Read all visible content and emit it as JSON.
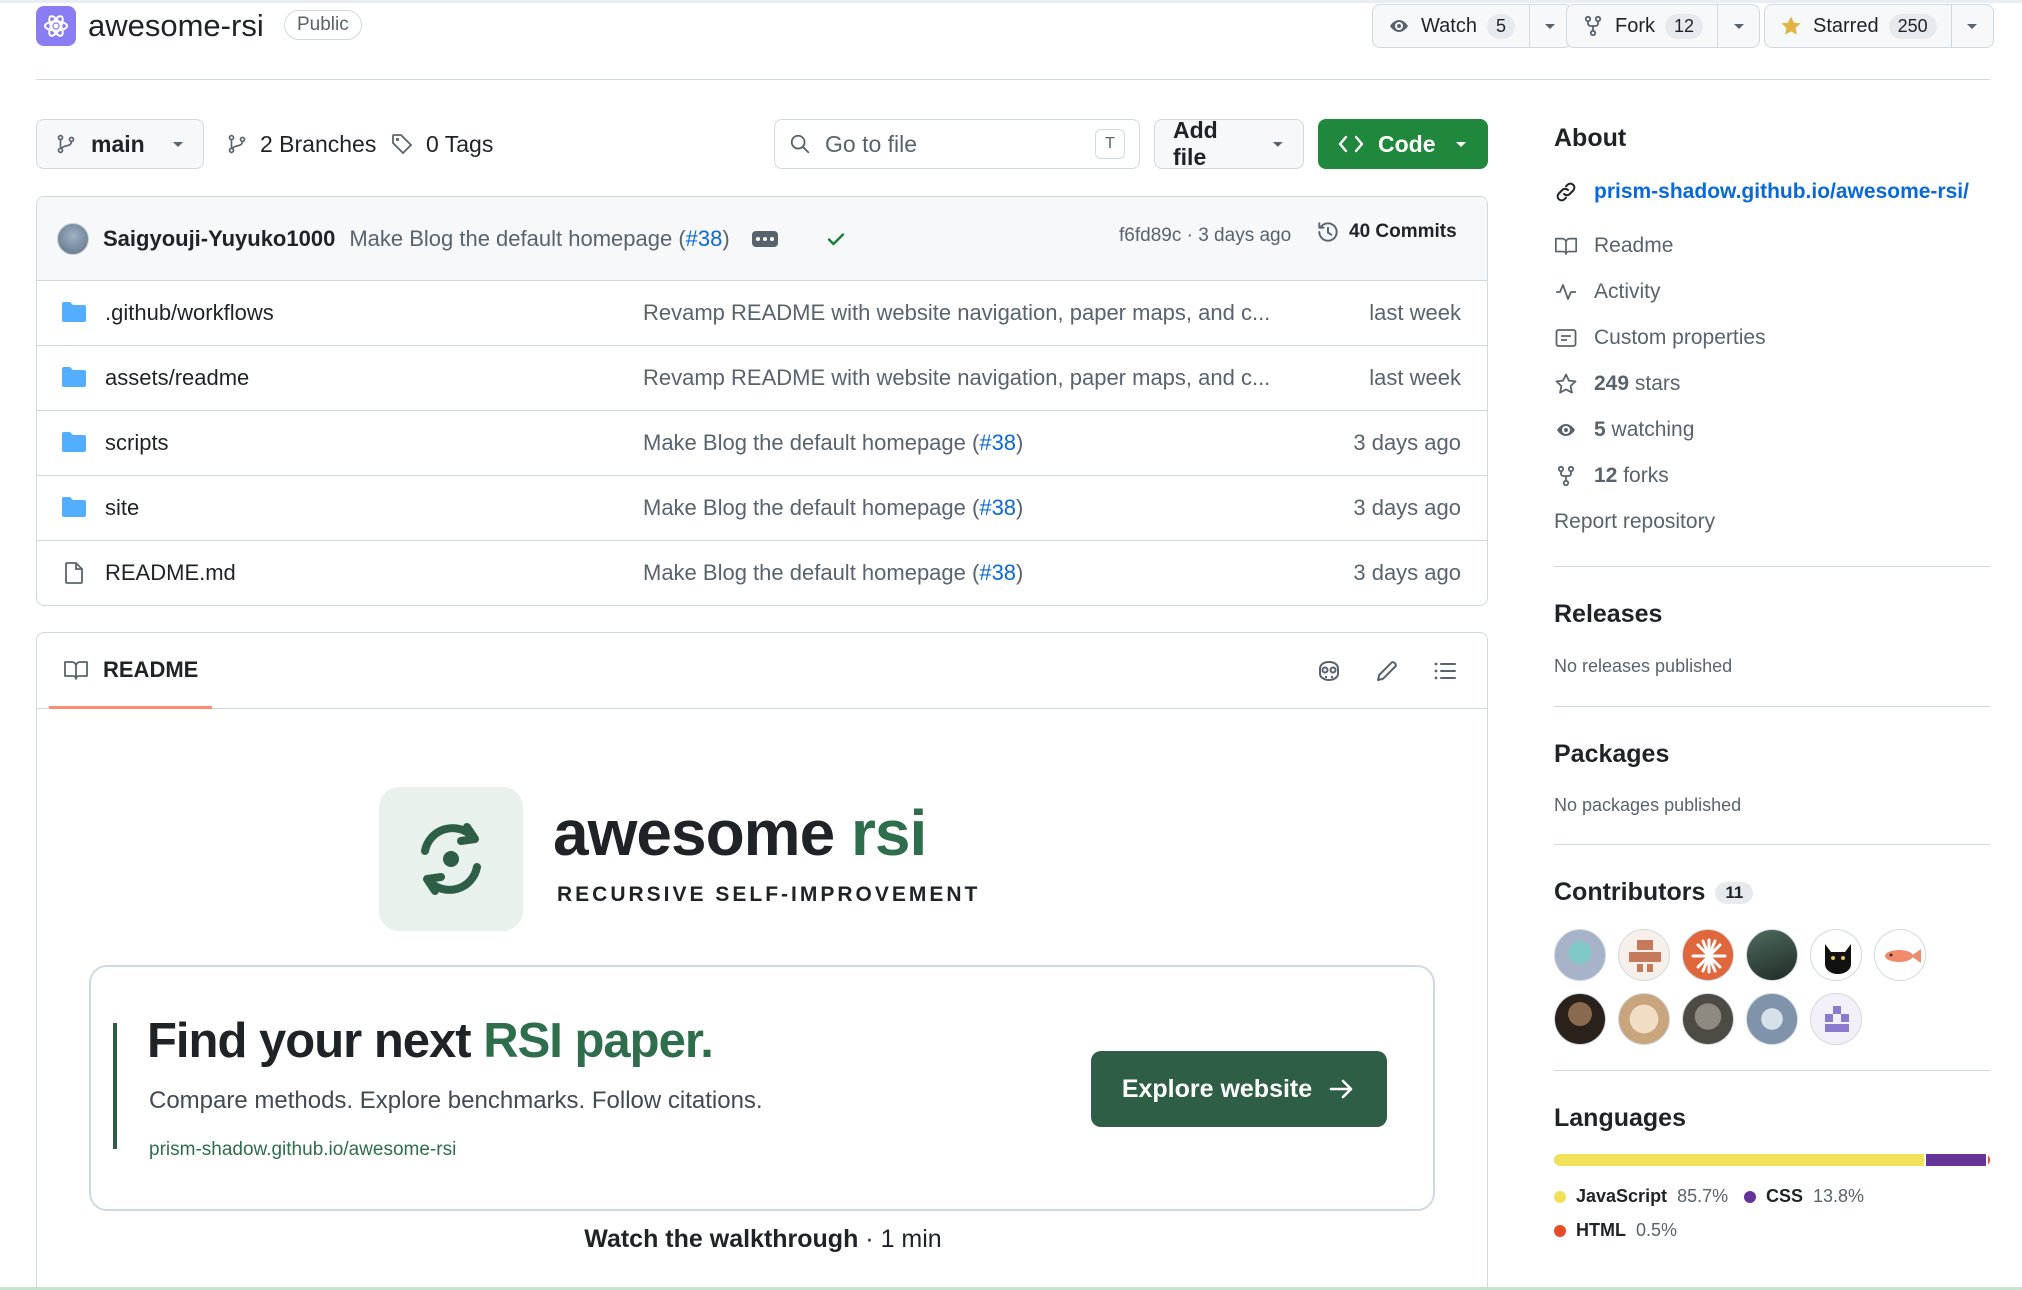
{
  "repo": {
    "name": "awesome-rsi",
    "visibility": "Public"
  },
  "header_actions": {
    "watch": {
      "label": "Watch",
      "count": "5"
    },
    "fork": {
      "label": "Fork",
      "count": "12"
    },
    "star": {
      "label": "Starred",
      "count": "250"
    }
  },
  "branch_bar": {
    "branch": "main",
    "branches": "2 Branches",
    "tags": "0 Tags",
    "search_placeholder": "Go to file",
    "search_shortcut": "T",
    "add_file": "Add file",
    "code": "Code"
  },
  "latest_commit": {
    "author": "Saigyouji-Yuyuko1000",
    "message": "Make Blog the default homepage (",
    "pr": "#38",
    "message_end": ")",
    "hash_time": "f6fd89c · 3 days ago",
    "commits": "40 Commits"
  },
  "files": [
    {
      "name": ".github/workflows",
      "type": "folder",
      "message": "Revamp README with website navigation, paper maps, and c...",
      "pr": "",
      "date": "last week"
    },
    {
      "name": "assets/readme",
      "type": "folder",
      "message": "Revamp README with website navigation, paper maps, and c...",
      "pr": "",
      "date": "last week"
    },
    {
      "name": "scripts",
      "type": "folder",
      "message": "Make Blog the default homepage (",
      "pr": "#38",
      "date": "3 days ago"
    },
    {
      "name": "site",
      "type": "folder",
      "message": "Make Blog the default homepage (",
      "pr": "#38",
      "date": "3 days ago"
    },
    {
      "name": "README.md",
      "type": "file",
      "message": "Make Blog the default homepage (",
      "pr": "#38",
      "date": "3 days ago"
    }
  ],
  "readme": {
    "tab": "README",
    "brand_name_a": "awesome ",
    "brand_name_b": "rsi",
    "brand_tagline": "RECURSIVE SELF-IMPROVEMENT",
    "hero_title_a": "Find your next ",
    "hero_title_b": "RSI paper.",
    "hero_sub": "Compare methods. Explore benchmarks. Follow citations.",
    "hero_url": "prism-shadow.github.io/awesome-rsi",
    "explore": "Explore website",
    "walkthrough_a": "Watch the walkthrough",
    "walkthrough_b": " · 1 min",
    "accent_color": "#2e5f46"
  },
  "about": {
    "title": "About",
    "website": "prism-shadow.github.io/awesome-rsi/",
    "readme": "Readme",
    "activity": "Activity",
    "custom_properties": "Custom properties",
    "stars": "249",
    "stars_label": " stars",
    "watching": "5",
    "watching_label": " watching",
    "forks": "12",
    "forks_label": " forks",
    "report": "Report repository"
  },
  "releases": {
    "title": "Releases",
    "empty": "No releases published"
  },
  "packages": {
    "title": "Packages",
    "empty": "No packages published"
  },
  "contributors": {
    "title": "Contributors",
    "count": "11"
  },
  "languages": {
    "title": "Languages",
    "items": [
      {
        "name": "JavaScript",
        "pct": "85.7%",
        "value": 85.7,
        "color": "#f1e05a"
      },
      {
        "name": "CSS",
        "pct": "13.8%",
        "value": 13.8,
        "color": "#663399"
      },
      {
        "name": "HTML",
        "pct": "0.5%",
        "value": 0.5,
        "color": "#e34c26"
      }
    ]
  }
}
